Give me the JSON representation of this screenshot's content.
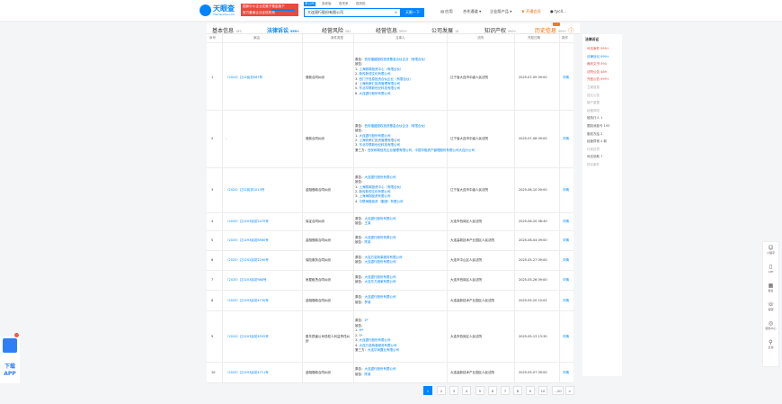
{
  "header": {
    "logo_text": "天眼查",
    "logo_sub": "TianYancha.com",
    "promo_line1": "国家中小企业发展子基金旗下",
    "promo_line2": "官方备案企业征信机构",
    "search_tabs": [
      "查公司",
      "查老板",
      "查关系",
      "查风险"
    ],
    "search_value": "大连银行股份有限公司",
    "search_button": "天眼一下",
    "nav": [
      "应用",
      "合作通道",
      "企业版产品",
      "开通会员",
      "tyc4..."
    ],
    "colors": {
      "brand": "#0084ff",
      "promo": "#e84a3b",
      "vip": "#e66a00"
    }
  },
  "tabs": [
    {
      "label": "基本信息",
      "count": "169"
    },
    {
      "label": "法律诉讼",
      "count": "999+"
    },
    {
      "label": "经营风险",
      "count": "281"
    },
    {
      "label": "经营信息",
      "count": "999+"
    },
    {
      "label": "公司发展",
      "count": "18"
    },
    {
      "label": "知识产权",
      "count": "999+"
    },
    {
      "label": "历史信息",
      "count": "999+"
    }
  ],
  "table": {
    "headers": [
      "序号",
      "案由",
      "案件类型",
      "当事人",
      "法院",
      "开庭日期",
      "操作"
    ],
    "rows": [
      {
        "no": "1",
        "case": "（2024）辽02民初587号",
        "type": "借款合同纠纷",
        "parties": [
          {
            "t": "原告：",
            "l": "西安福盛股权投资基金合伙企业（有限合伙）"
          },
          {
            "t": "被告：",
            "l": ""
          },
          {
            "t": "1. ",
            "l": "上海顺闻投资中心（有限合伙）"
          },
          {
            "t": "2. ",
            "l": "新传新领文化有限公司"
          },
          {
            "t": "3. ",
            "l": "西门子信息投资合伙企业（有限合伙）"
          },
          {
            "t": "4. ",
            "l": "上海帆荣汇投资管理有限公司"
          },
          {
            "t": "5. ",
            "l": "东北华联新世纪科技有限公司"
          },
          {
            "t": "6. ",
            "l": "大连银行股份有限公司"
          }
        ],
        "court": "辽宁省大连市中级人民法院",
        "date": "2025-07-09 09:00",
        "action": "详情"
      },
      {
        "no": "2",
        "case": "-",
        "type": "借款合同纠纷",
        "parties": [
          {
            "t": "原告：",
            "l": "西安福盛股权投资基金合伙企业（有限合伙）"
          },
          {
            "t": "被告：",
            "l": ""
          },
          {
            "t": "1. ",
            "l": "大连银行股份有限公司"
          },
          {
            "t": "2. ",
            "l": "上海帆荣汇投资管理有限公司"
          },
          {
            "t": "3. ",
            "l": "东北华联新世纪科技有限公司"
          },
          {
            "t": "第三方：",
            "l": "西安和硕信托企业管理有限公司，中国华融资产管理股份有限公司大连分公司"
          }
        ],
        "court": "辽宁省大连市中级人民法院",
        "date": "2025-07-08 09:00",
        "action": "详情"
      },
      {
        "no": "3",
        "case": "（2024）辽02民初1013号",
        "type": "金融借款合同纠纷",
        "parties": [
          {
            "t": "原告：",
            "l": "大连银行股份有限公司"
          },
          {
            "t": "被告：",
            "l": ""
          },
          {
            "t": "1. ",
            "l": "上海顺闻投资中心（有限合伙）"
          },
          {
            "t": "2. ",
            "l": "新传新领文化有限公司"
          },
          {
            "t": "3. ",
            "l": "上海海翔投资有限公司"
          },
          {
            "t": "4. ",
            "l": "中联海融投资（集团）有限公司"
          }
        ],
        "court": "辽宁省大连市中级人民法院",
        "date": "2025-06-10 09:00",
        "action": "详情"
      },
      {
        "no": "4",
        "case": "（2025）辽0203民初2470号",
        "type": "保证合同纠纷",
        "parties": [
          {
            "t": "原告：",
            "l": "大连银行股份有限公司"
          },
          {
            "t": "被告：",
            "l": "王某"
          }
        ],
        "court": "大连市西岗区人民法院",
        "date": "2025-06-20 08:40",
        "action": "详情"
      },
      {
        "no": "5",
        "case": "（2025）辽0293民初8980号",
        "type": "金融借款合同纠纷",
        "parties": [
          {
            "t": "原告：",
            "l": "大连银行股份有限公司"
          },
          {
            "t": "被告：",
            "l": "陈某"
          }
        ],
        "court": "大连高新技术产业园区人民法院",
        "date": "2025-06-04 09:00",
        "action": "详情"
      },
      {
        "no": "6",
        "case": "（2025）辽0202民初2290号",
        "type": "保险服务合同纠纷",
        "parties": [
          {
            "t": "原告：",
            "l": "大连方诺商事服务有限公司"
          },
          {
            "t": "被告：",
            "l": "大连银行股份有限公司"
          }
        ],
        "court": "大连市中山区人民法院",
        "date": "2025-05-27 09:00",
        "action": "详情"
      },
      {
        "no": "7",
        "case": "（2025）辽0203民初988号",
        "type": "房屋租赁合同纠纷",
        "parties": [
          {
            "t": "原告：",
            "l": "大连银行股份有限公司"
          },
          {
            "t": "被告：",
            "l": "大连东方酒家有限公司"
          }
        ],
        "court": "大连市西岗区人民法院",
        "date": "2025-05-26 09:00",
        "action": "详情"
      },
      {
        "no": "8",
        "case": "（2025）辽0293民初4730号",
        "type": "金融借款合同纠纷",
        "parties": [
          {
            "t": "原告：",
            "l": "大连银行股份有限公司"
          },
          {
            "t": "被告：",
            "l": "罗某"
          }
        ],
        "court": "大连高新技术产业园区人民法院",
        "date": "2025-05-20 10:02",
        "action": "详情"
      },
      {
        "no": "9",
        "case": "（2024）辽0203民初4555号",
        "type": "股东损害公司债权人利益责任纠纷",
        "parties": [
          {
            "t": "原告：",
            "l": "Z*"
          },
          {
            "t": "被告：",
            "l": ""
          },
          {
            "t": "1. ",
            "l": "M*"
          },
          {
            "t": "2. ",
            "l": "S*"
          },
          {
            "t": "3. ",
            "l": "大连银行股份有限公司"
          },
          {
            "t": "4. ",
            "l": "大连方诺商事服务有限公司"
          },
          {
            "t": "第三方：",
            "l": "大连华润置业有限公司"
          }
        ],
        "court": "大连市西岗区人民法院",
        "date": "2025-05-13 13:30",
        "action": "详情"
      },
      {
        "no": "10",
        "case": "（2025）辽0293民初4711号",
        "type": "金融借款合同纠纷",
        "parties": [
          {
            "t": "原告：",
            "l": "大连银行股份有限公司"
          },
          {
            "t": "被告：",
            "l": "陈某"
          }
        ],
        "court": "大连高新技术产业园区人民法院",
        "date": "2025-05-07 09:00",
        "action": "详情"
      }
    ]
  },
  "pagination": [
    "1",
    "2",
    "3",
    "4",
    "5",
    "6",
    "7",
    "8",
    "9",
    "10",
    "...20",
    ">"
  ],
  "side": {
    "title": "法律诉讼",
    "items": [
      {
        "label": "司法案件 999+",
        "color": "#e84a3b"
      },
      {
        "label": "法律诉讼 999+",
        "color": "#0084ff"
      },
      {
        "label": "裁判文书 390",
        "color": "#e84a3b"
      },
      {
        "label": "法院公告 489",
        "color": "#e84a3b"
      },
      {
        "label": "开庭公告 999+",
        "color": "#e84a3b"
      },
      {
        "label": "立案信息",
        "color": "#aaa"
      },
      {
        "label": "送达公告",
        "color": "#aaa"
      },
      {
        "label": "破产重整",
        "color": "#aaa"
      },
      {
        "label": "经营风险",
        "color": "#aaa"
      },
      {
        "label": "被执行人 1",
        "color": "#555"
      },
      {
        "label": "限制消费令 193",
        "color": "#555"
      },
      {
        "label": "股权冻结 2",
        "color": "#555"
      },
      {
        "label": "经营异常 4 新",
        "color": "#555"
      },
      {
        "label": "行政处罚",
        "color": "#aaa"
      },
      {
        "label": "司法协助 7",
        "color": "#555"
      },
      {
        "label": "终本案件",
        "color": "#aaa"
      }
    ]
  },
  "right_tools": [
    {
      "icon": "☺",
      "label": "小程序"
    },
    {
      "icon": "▯",
      "label": "APP"
    },
    {
      "icon": "▦",
      "label": "报名"
    },
    {
      "icon": "☏",
      "label": "客服"
    },
    {
      "icon": "◎",
      "label": "服务中心"
    },
    {
      "icon": "⚲",
      "label": "反馈"
    }
  ],
  "download": {
    "label": "下载APP"
  }
}
